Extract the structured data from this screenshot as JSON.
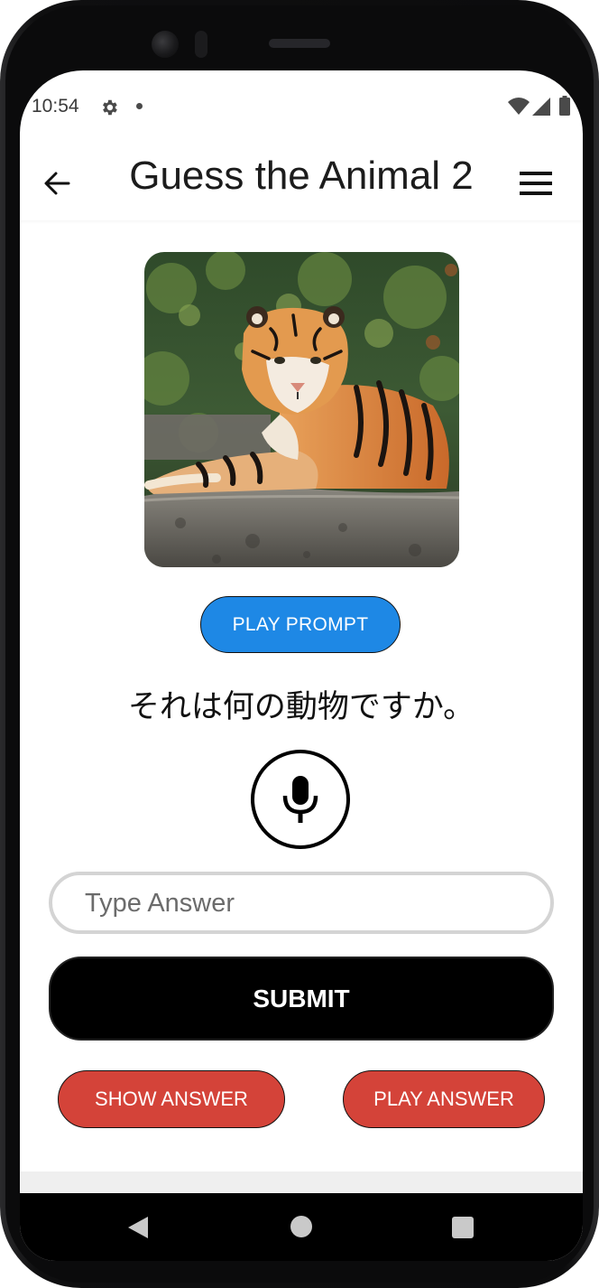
{
  "status_bar": {
    "time": "10:54",
    "icons": [
      "gear-icon",
      "notification-dot-icon",
      "wifi-icon",
      "cell-signal-icon",
      "battery-icon"
    ]
  },
  "app_bar": {
    "title": "Guess the Animal 2",
    "back_icon": "arrow-back-icon",
    "menu_icon": "hamburger-menu-icon"
  },
  "prompt": {
    "image_subject": "tiger",
    "play_prompt_label": "PLAY PROMPT",
    "question": "それは何の動物ですか。"
  },
  "answer": {
    "mic_icon": "microphone-icon",
    "placeholder": "Type Answer",
    "value": "",
    "submit_label": "SUBMIT"
  },
  "actions": {
    "show_answer_label": "SHOW ANSWER",
    "play_answer_label": "PLAY ANSWER"
  },
  "nav_bar": {
    "icons": [
      "nav-back-icon",
      "nav-home-icon",
      "nav-recents-icon"
    ]
  },
  "colors": {
    "play_prompt": "#1e88e5",
    "submit": "#000000",
    "answer_buttons": "#d44339"
  }
}
